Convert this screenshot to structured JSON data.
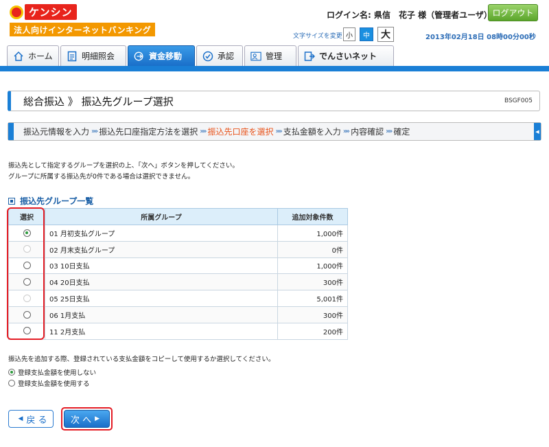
{
  "brand": {
    "name": "ケンシン",
    "subtitle": "法人向けインターネットバンキング"
  },
  "header": {
    "login_label": "ログイン名: 県信　花子 様（管理者ユーザ）",
    "logout_label": "ログアウト",
    "font_size_label": "文字サイズを変更",
    "font_sizes": [
      "小",
      "中",
      "大"
    ],
    "datetime": "2013年02月18日 08時00分00秒"
  },
  "nav": {
    "items": [
      {
        "label": "ホーム",
        "icon": "home-icon"
      },
      {
        "label": "明細照会",
        "icon": "document-icon"
      },
      {
        "label": "資金移動",
        "icon": "transfer-icon"
      },
      {
        "label": "承認",
        "icon": "check-icon"
      },
      {
        "label": "管理",
        "icon": "user-manage-icon"
      },
      {
        "label": "でんさいネット",
        "icon": "densai-icon"
      }
    ],
    "active_index": 2
  },
  "page": {
    "title": "総合振込 》 振込先グループ選択",
    "code": "BSGF005"
  },
  "steps": {
    "items": [
      "振込元情報を入力",
      "振込先口座指定方法を選択",
      "振込先口座を選択",
      "支払金額を入力",
      "内容確認",
      "確定"
    ],
    "current_index": 2,
    "separator": "»»"
  },
  "instructions": [
    "振込先として指定するグループを選択の上、「次へ」ボタンを押してください。",
    "グループに所属する振込先が0件である場合は選択できません。"
  ],
  "group_list": {
    "title": "振込先グループ一覧",
    "headers": {
      "select": "選択",
      "group": "所属グループ",
      "count": "追加対象件数"
    },
    "rows": [
      {
        "group": "01 月初支払グループ",
        "count": "1,000件",
        "state": "checked"
      },
      {
        "group": "02 月末支払グループ",
        "count": "0件",
        "state": "disabled"
      },
      {
        "group": "03 10日支払",
        "count": "1,000件",
        "state": "enabled"
      },
      {
        "group": "04 20日支払",
        "count": "300件",
        "state": "enabled"
      },
      {
        "group": "05 25日支払",
        "count": "5,001件",
        "state": "disabled"
      },
      {
        "group": "06 1月支払",
        "count": "300件",
        "state": "enabled"
      },
      {
        "group": "11 2月支払",
        "count": "200件",
        "state": "enabled"
      }
    ]
  },
  "copy_option": {
    "question": "振込先を追加する際、登録されている支払金額をコピーして使用するか選択してください。",
    "options": [
      {
        "label": "登録支払金額を使用しない",
        "checked": true
      },
      {
        "label": "登録支払金額を使用する",
        "checked": false
      }
    ]
  },
  "buttons": {
    "back": "戻 る",
    "next": "次 へ"
  },
  "colors": {
    "accent": "#1a7fd6",
    "highlight": "#e41c24",
    "current_step": "#e8541c"
  }
}
